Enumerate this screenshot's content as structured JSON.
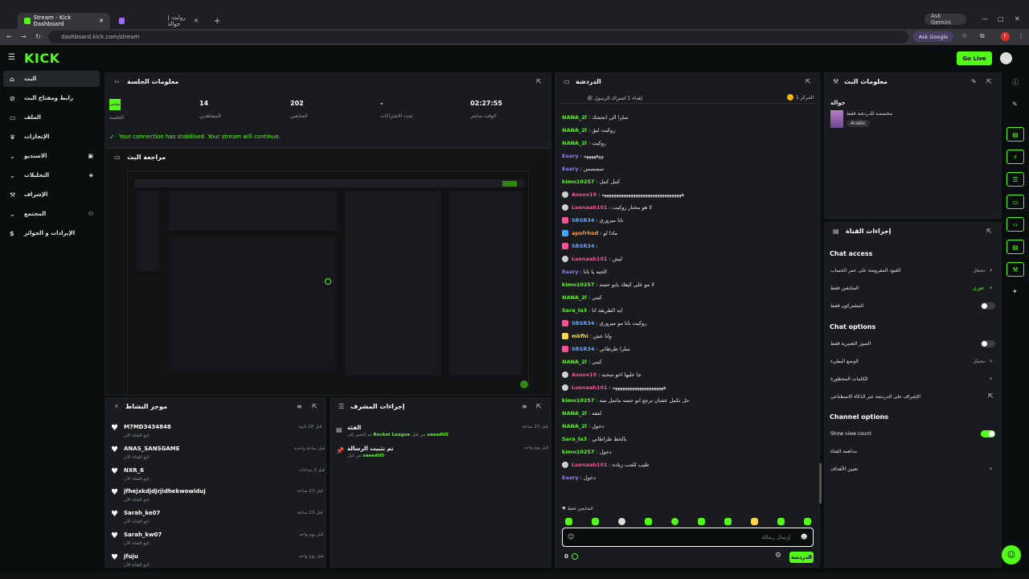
{
  "browser": {
    "tabs": [
      {
        "label": "Stream - Kick Dashboard"
      },
      {
        "label": "روايت | جوالة"
      }
    ],
    "url": "dashboard.kick.com/stream",
    "ask_gemini": "Ask Gemini",
    "ask_google": "Ask Google",
    "profile_initial": "F"
  },
  "topnav": {
    "logo": "KICK",
    "go_live": "Go Live"
  },
  "sidebar": {
    "items": [
      {
        "label": "البث",
        "icon": "home-icon"
      },
      {
        "label": "رابط ومفتاح البث",
        "icon": "link-icon"
      },
      {
        "label": "الملف",
        "icon": "file-icon"
      },
      {
        "label": "الإنجازات",
        "icon": "trophy-icon"
      },
      {
        "label": "الاستديو",
        "icon": "studio-icon"
      },
      {
        "label": "التحليلات",
        "icon": "analytics-icon"
      },
      {
        "label": "الإشراف",
        "icon": "hammer-icon"
      },
      {
        "label": "المجتمع",
        "icon": "community-icon"
      },
      {
        "label": "الإيرادات و الجوائز",
        "icon": "revenue-icon"
      }
    ]
  },
  "session": {
    "title": "معلومات الجلسة",
    "live_badge": "مباشر",
    "live_label": "الجلسة",
    "stats": [
      {
        "value": "14",
        "label": "المشاهدين"
      },
      {
        "value": "202",
        "label": "المتابعين"
      },
      {
        "value": "-",
        "label": "تجدد الاشتراكات"
      },
      {
        "value": "02:27:55",
        "label": "الوقت مباشر"
      }
    ],
    "notice": "Your connection has stabilised. Your stream will continue."
  },
  "preview": {
    "title": "مراجعة البث"
  },
  "activity": {
    "title": "موجز النشاط",
    "items": [
      {
        "name": "M7MD3434848",
        "sub": "تابع القناة الآن",
        "time": "قبل 18 ثانية"
      },
      {
        "name": "ANAS_SANSGAME",
        "sub": "تابع القناة الآن",
        "time": "قبل ساعة واحدة"
      },
      {
        "name": "NXR_6",
        "sub": "تابع القناة الآن",
        "time": "قبل 3 ساعات"
      },
      {
        "name": "jfhejxkdjdjrjidhekwowiduj",
        "sub": "تابع القناة الآن",
        "time": "قبل 23 ساعة"
      },
      {
        "name": "Sarah_ke07",
        "sub": "تابع القناة الآن",
        "time": "قبل 23 ساعة"
      },
      {
        "name": "Sarah_kw07",
        "sub": "تابع القناة الآن",
        "time": "قبل يوم واحد"
      },
      {
        "name": "jfuju",
        "sub": "تابع القناة الآن",
        "time": "قبل يوم واحد"
      }
    ]
  },
  "modactions": {
    "title": "إجراءات المشرف",
    "items": [
      {
        "title": "الفئة",
        "desc_a": "تم التغيير إلى",
        "category": "Rocket League",
        "desc_b": "من قبل",
        "user": "saeedV0",
        "time": "قبل 23 ساعة"
      },
      {
        "title": "تم تثبيت الرسالة",
        "desc_a": "من قبل",
        "category": "",
        "desc_b": "",
        "user": "saeedV0",
        "time": "قبل يوم واحد"
      }
    ]
  },
  "chat": {
    "title": "الدردشة",
    "pinned_left": "إهداء 1 اشتراك الرسول ﷺ",
    "pinned_right": "المركز 1",
    "messages": [
      {
        "user": "NANA_2l",
        "color": "#53fc18",
        "text": "سلرا الي انحشك",
        "badge": ""
      },
      {
        "user": "NANA_2l",
        "color": "#53fc18",
        "text": "روكيت ليق",
        "badge": ""
      },
      {
        "user": "NANA_2l",
        "color": "#53fc18",
        "text": "روكيت",
        "badge": ""
      },
      {
        "user": "Eaary",
        "color": "#8c7dff",
        "text": "ووهههههه",
        "badge": ""
      },
      {
        "user": "Eaary",
        "color": "#8c7dff",
        "text": "سسسس",
        "badge": ""
      },
      {
        "user": "kimo10257",
        "color": "#53fc18",
        "text": "كمل كمل",
        "badge": ""
      },
      {
        "user": "Asoox19",
        "color": "#ff4f9a",
        "text": "هههههههههههههههههههههههههههههههههه",
        "badge": "gray"
      },
      {
        "user": "Leenaah101",
        "color": "#ff4f9a",
        "text": "لا هو مختار روكيت",
        "badge": "gray"
      },
      {
        "user": "SRSR34",
        "color": "#6aa8ff",
        "text": "نانا ميروري",
        "badge": "pink"
      },
      {
        "user": "apofrhod",
        "color": "#ff9a3a",
        "text": "ماذا لو",
        "badge": "blue"
      },
      {
        "user": "SRSR34",
        "color": "#6aa8ff",
        "text": "",
        "badge": "pink"
      },
      {
        "user": "Leenaah101",
        "color": "#ff4f9a",
        "text": "ليش",
        "badge": "gray"
      },
      {
        "user": "Eaary",
        "color": "#8c7dff",
        "text": "الحيه يا نانا",
        "badge": ""
      },
      {
        "user": "kimo10257",
        "color": "#53fc18",
        "text": "لا مو على كيفك يابو حسه",
        "badge": ""
      },
      {
        "user": "NANA_2l",
        "color": "#53fc18",
        "text": "كيني",
        "badge": ""
      },
      {
        "user": "Sara_la3",
        "color": "#53fc18",
        "text": "ايه الطريقة انا",
        "badge": ""
      },
      {
        "user": "SRSR34",
        "color": "#6aa8ff",
        "text": "روكيت نانا مو ميروري",
        "badge": "pink"
      },
      {
        "user": "mkfhi",
        "color": "#ffd84a",
        "text": "وانا عش",
        "badge": "yel"
      },
      {
        "user": "SRSR34",
        "color": "#6aa8ff",
        "text": "سلرا طرطاني",
        "badge": "pink"
      },
      {
        "user": "NANA_2l",
        "color": "#53fc18",
        "text": "كيني",
        "badge": ""
      },
      {
        "user": "Asoox19",
        "color": "#ff4f9a",
        "text": "جا عليها اخو سحبه",
        "badge": "gray"
      },
      {
        "user": "Leenaah101",
        "color": "#ff4f9a",
        "text": "هههههههههههههههههههههه",
        "badge": "gray"
      },
      {
        "user": "kimo10257",
        "color": "#53fc18",
        "text": "حل تكمل عشان ترجع ابو حسه ماتمل منه",
        "badge": ""
      },
      {
        "user": "NANA_2l",
        "color": "#53fc18",
        "text": "لفقه",
        "badge": ""
      },
      {
        "user": "NANA_2l",
        "color": "#53fc18",
        "text": "دخول",
        "badge": ""
      },
      {
        "user": "Sara_la3",
        "color": "#53fc18",
        "text": "بالخط طراطاني",
        "badge": ""
      },
      {
        "user": "kimo10257",
        "color": "#53fc18",
        "text": "دخول",
        "badge": ""
      },
      {
        "user": "Leenaah101",
        "color": "#ff4f9a",
        "text": "طيب للحب زياده",
        "badge": "gray"
      },
      {
        "user": "Eaary",
        "color": "#8c7dff",
        "text": "دخول",
        "badge": ""
      }
    ],
    "followers_only": "المتابعين فقط",
    "placeholder": "إرسال رسالة",
    "send": "الدردشة",
    "points": "0"
  },
  "streaminfo": {
    "title": "معلومات البث",
    "stream_title": "جوالة",
    "category": "مخصصة للدردشة فقط",
    "language": "Arabic"
  },
  "channel_actions": {
    "title": "إجراءات القناة",
    "chat_access": {
      "heading": "Chat access",
      "rows": [
        {
          "label": "القيود المفروضة على عمر الحساب",
          "value": "معطل",
          "type": "chevron"
        },
        {
          "label": "المتابعين فقط",
          "value": "فوري",
          "type": "chevron"
        },
        {
          "label": "المشتركون فقط",
          "value": "",
          "type": "toggle-off"
        }
      ]
    },
    "chat_options": {
      "heading": "Chat options",
      "rows": [
        {
          "label": "الصور التعبيرية فقط",
          "value": "",
          "type": "toggle-off"
        },
        {
          "label": "الوضع البطيء",
          "value": "معطل",
          "type": "chevron"
        },
        {
          "label": "الكلمات المحظورة",
          "value": "",
          "type": "chevron"
        },
        {
          "label": "الإشراف على الدردشة عبر الذكاء الاصطناعي",
          "value": "",
          "type": "external"
        }
      ]
    },
    "channel_options": {
      "heading": "Channel options",
      "rows": [
        {
          "label": "Show view count",
          "value": "",
          "type": "toggle-on"
        },
        {
          "label": "مداهمة القناة",
          "value": "",
          "type": "none"
        },
        {
          "label": "تعيين الأهداف",
          "value": "",
          "type": "chevron"
        }
      ]
    }
  },
  "colors": {
    "accent": "#53fc18",
    "panel": "#191b1f",
    "bg": "#0b0e0f"
  }
}
